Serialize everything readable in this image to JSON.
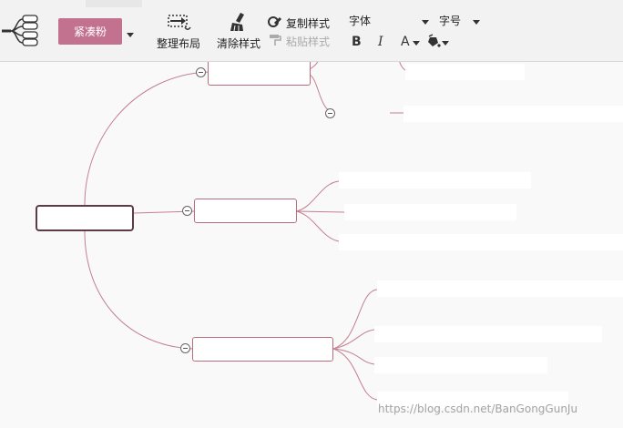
{
  "toolbar": {
    "theme_label": "紧凑粉",
    "arrange_label": "整理布局",
    "clear_style_label": "清除样式",
    "copy_style_label": "复制样式",
    "paste_style_label": "粘贴样式",
    "font_label": "字体",
    "font_size_label": "字号",
    "bold_label": "B",
    "italic_label": "I",
    "font_color_label": "A",
    "accent_color": "#c2718f"
  },
  "watermark": "https://blog.csdn.net/BanGongGunJu",
  "colors": {
    "branch_line": "#c47f91",
    "root_border": "#5e3b48",
    "node_border": "#b86c7e"
  }
}
